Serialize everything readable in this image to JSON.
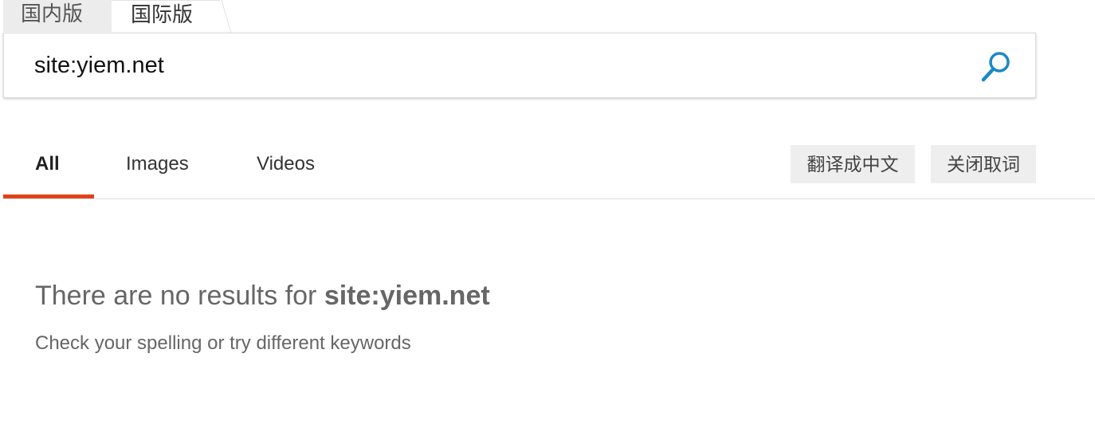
{
  "region_tabs": {
    "domestic": "国内版",
    "international": "国际版",
    "active": "international"
  },
  "search": {
    "value": "site:yiem.net",
    "icon": "search-icon",
    "icon_color": "#1b88c7"
  },
  "nav": {
    "tabs": [
      {
        "label": "All",
        "active": true
      },
      {
        "label": "Images",
        "active": false
      },
      {
        "label": "Videos",
        "active": false
      }
    ],
    "translate_button": "翻译成中文",
    "close_words_button": "关闭取词",
    "accent_color": "#e0431b"
  },
  "results": {
    "no_results_prefix": "There are no results for ",
    "no_results_query": "site:yiem.net",
    "hint": "Check your spelling or try different keywords"
  }
}
